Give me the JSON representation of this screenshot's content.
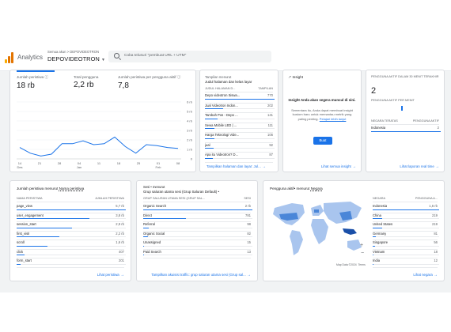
{
  "header": {
    "app_name": "Analytics",
    "account_path": "Semua akun > DEPOVIDEOTRON",
    "property_name": "DEPOVIDEOTRON",
    "search_placeholder": "Coba telusuri \"pembuat URL + UTM\""
  },
  "overview": {
    "metrics": [
      {
        "label": "Jumlah peristiwa",
        "value": "18 rb"
      },
      {
        "label": "Total pengguna",
        "value": "2,2 rb"
      },
      {
        "label": "Jumlah peristiwa per pengguna aktif",
        "value": "7,8"
      }
    ],
    "chart_data": {
      "type": "line",
      "title": "",
      "x": [
        "14 Des",
        "21",
        "28",
        "04 Jan",
        "11",
        "18",
        "25",
        "01 Feb",
        "08"
      ],
      "y_ticks": [
        "6 rb",
        "5 rb",
        "4 rb",
        "3 rb",
        "2 rb",
        "1 rb",
        "0"
      ],
      "ylim": [
        0,
        6000
      ],
      "series": [
        {
          "values": [
            1200,
            600,
            300,
            500,
            1600,
            1600,
            1900,
            1500,
            1600,
            2300,
            1300,
            600,
            1500,
            1400,
            1200,
            1100
          ]
        }
      ]
    }
  },
  "pages_card": {
    "title_line1": "Tampilan menurut",
    "title_line2": "Judul halaman dan kelas layar",
    "col_key": "JUDUL HALAMAN D...",
    "col_val": "TAMPILAN",
    "rows": [
      {
        "label": "Depo videotron Siswa...",
        "value": "770",
        "pct": 1.0
      },
      {
        "label": "Jual Videotron Indon...",
        "value": "202",
        "pct": 0.26
      },
      {
        "label": "Tambah Pos - Depo ...",
        "value": "141",
        "pct": 0.18
      },
      {
        "label": "Sewa Mobile LED | ...",
        "value": "111",
        "pct": 0.14
      },
      {
        "label": "Harga Teknologi Vide...",
        "value": "106",
        "pct": 0.14
      },
      {
        "label": "jual",
        "value": "92",
        "pct": 0.12
      },
      {
        "label": "Apa itu Videotron? D...",
        "value": "87",
        "pct": 0.11
      }
    ],
    "footer_link": "Tampilkan halaman dan layar: Jul..."
  },
  "insight_card": {
    "title": "Insight",
    "heading": "Insight Anda akan segera muncul di sini.",
    "body": "Sementara itu, Anda dapat membuat insight kustom baru untuk memantau metrik yang paling penting.",
    "body_link": "Pelajari lebih lanjut",
    "button": "Buat",
    "footer_link": "Lihat semua insight"
  },
  "realtime_card": {
    "title": "PENGGUNA AKTIF DALAM 30 MENIT TERAKHIR",
    "value": "2",
    "per_minute_label": "PENGGUNA AKTIF PER MENIT",
    "col_key": "NEGARA TERATAS",
    "col_val": "PENGGUNA AKTIF",
    "rows": [
      {
        "label": "Indonesia",
        "value": "2"
      }
    ],
    "footer_link": "Lihat laporan real time"
  },
  "events_card": {
    "title_prefix": "Jumlah peristiwa menurut",
    "title_dim": "Nama peristiwa",
    "col_key": "NAMA PERISTIWA",
    "col_val": "JUMLAH PERISTIWA",
    "rows": [
      {
        "label": "page_view",
        "value": "5,7 rb",
        "pct": 1.0
      },
      {
        "label": "user_engagement",
        "value": "3,8 rb",
        "pct": 0.67
      },
      {
        "label": "session_start",
        "value": "2,9 rb",
        "pct": 0.51
      },
      {
        "label": "first_visit",
        "value": "2,2 rb",
        "pct": 0.39
      },
      {
        "label": "scroll",
        "value": "1,6 rb",
        "pct": 0.28
      },
      {
        "label": "click",
        "value": "407",
        "pct": 0.07
      },
      {
        "label": "form_start",
        "value": "201",
        "pct": 0.035
      }
    ],
    "footer_link": "Lihat peristiwa"
  },
  "traffic_card": {
    "title_line1": "Sesi • menurut",
    "title_line2": "Grup saluran utama sesi (Grup Saluran Default) •",
    "col_key": "GRUP SALURAN UTAMA SESI (GRUP SAL...",
    "col_val": "SESI",
    "rows": [
      {
        "label": "Organic Search",
        "value": "2 rb",
        "pct": 1.0
      },
      {
        "label": "Direct",
        "value": "781",
        "pct": 0.39
      },
      {
        "label": "Referral",
        "value": "98",
        "pct": 0.05
      },
      {
        "label": "Organic Social",
        "value": "82",
        "pct": 0.04
      },
      {
        "label": "Unassigned",
        "value": "15",
        "pct": 0.008
      },
      {
        "label": "Paid Search",
        "value": "13",
        "pct": 0.006
      }
    ],
    "footer_link": "Tampilkan akuisisi traffic: grup saluran utama sesi (Grup sal..."
  },
  "geo_card": {
    "title_prefix": "Pengguna aktif• menurut",
    "title_dim": "Negara",
    "col_key": "NEGARA",
    "col_val": "PENGGUNA A...",
    "rows": [
      {
        "label": "Indonesia",
        "value": "1,6 rb",
        "pct": 1.0
      },
      {
        "label": "China",
        "value": "219",
        "pct": 0.14
      },
      {
        "label": "United States",
        "value": "219",
        "pct": 0.14
      },
      {
        "label": "Germany",
        "value": "81",
        "pct": 0.05
      },
      {
        "label": "Singapore",
        "value": "56",
        "pct": 0.035
      },
      {
        "label": "Vietnam",
        "value": "18",
        "pct": 0.011
      },
      {
        "label": "India",
        "value": "12",
        "pct": 0.008
      }
    ],
    "map_attribution": "Map Data ©2024",
    "map_terms": "Terms",
    "footer_link": "Lihat negara"
  },
  "colors": {
    "accent": "#1a73e8",
    "map_dark": "#1a4fa8",
    "map_mid": "#4a86d8",
    "map_light": "#a9c5ee"
  }
}
